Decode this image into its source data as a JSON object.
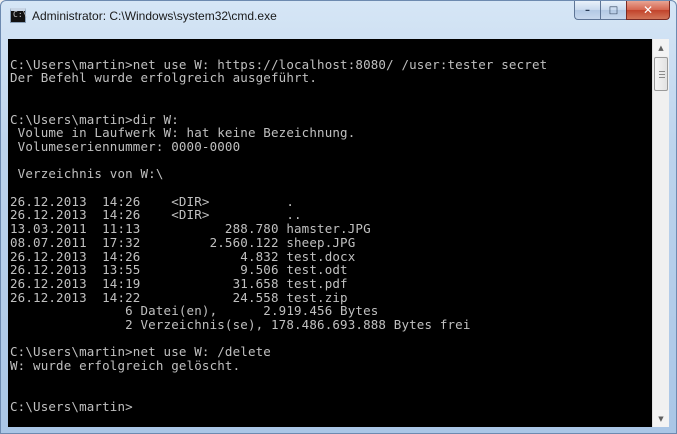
{
  "window": {
    "title": "Administrator: C:\\Windows\\system32\\cmd.exe",
    "icon_text": "C:\\"
  },
  "caption_buttons": {
    "minimize": "–",
    "maximize": "□",
    "close": "✕"
  },
  "console": {
    "lines": [
      "",
      "C:\\Users\\martin>net use W: https://localhost:8080/ /user:tester secret",
      "Der Befehl wurde erfolgreich ausgeführt.",
      "",
      "",
      "C:\\Users\\martin>dir W:",
      " Volume in Laufwerk W: hat keine Bezeichnung.",
      " Volumeseriennummer: 0000-0000",
      "",
      " Verzeichnis von W:\\",
      "",
      "26.12.2013  14:26    <DIR>          .",
      "26.12.2013  14:26    <DIR>          ..",
      "13.03.2011  11:13           288.780 hamster.JPG",
      "08.07.2011  17:32         2.560.122 sheep.JPG",
      "26.12.2013  14:26             4.832 test.docx",
      "26.12.2013  13:55             9.506 test.odt",
      "26.12.2013  14:19            31.658 test.pdf",
      "26.12.2013  14:22            24.558 test.zip",
      "               6 Datei(en),      2.919.456 Bytes",
      "               2 Verzeichnis(se), 178.486.693.888 Bytes frei",
      "",
      "C:\\Users\\martin>net use W: /delete",
      "W: wurde erfolgreich gelöscht.",
      "",
      "",
      "C:\\Users\\martin>"
    ]
  },
  "scrollbar": {
    "up_arrow": "▲",
    "down_arrow": "▼"
  }
}
